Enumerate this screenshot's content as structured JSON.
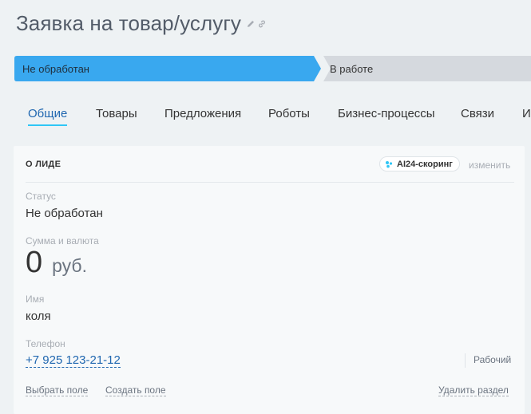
{
  "header": {
    "title": "Заявка на  товар/услугу",
    "edit_icon": "pencil-icon",
    "link_icon": "link-icon"
  },
  "stages": {
    "items": [
      {
        "label": "Не обработан",
        "active": true
      },
      {
        "label": "В работе",
        "active": false
      }
    ],
    "colors": {
      "active": "#39a8ef",
      "inactive": "#d5d9de"
    }
  },
  "tabs": [
    {
      "label": "Общие",
      "active": true
    },
    {
      "label": "Товары"
    },
    {
      "label": "Предложения"
    },
    {
      "label": "Роботы"
    },
    {
      "label": "Бизнес-процессы"
    },
    {
      "label": "Связи"
    },
    {
      "label": "И"
    }
  ],
  "card": {
    "section_title": "О ЛИДЕ",
    "ai_scoring_label": "AI24-скоринг",
    "change_label": "изменить",
    "fields": {
      "status": {
        "label": "Статус",
        "value": "Не обработан"
      },
      "sum": {
        "label": "Сумма и валюта",
        "value": "0",
        "currency": "руб."
      },
      "name": {
        "label": "Имя",
        "value": "коля"
      },
      "phone": {
        "label": "Телефон",
        "value": "+7 925 123-21-12",
        "type": "Рабочий"
      }
    },
    "actions": {
      "choose_field": "Выбрать поле",
      "create_field": "Создать поле",
      "delete_section": "Удалить раздел"
    }
  }
}
